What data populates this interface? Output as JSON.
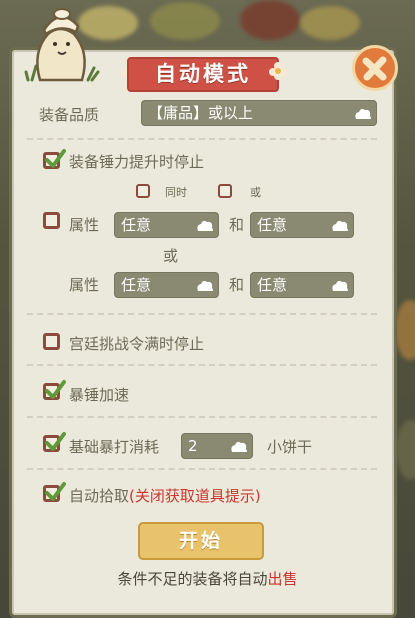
{
  "title": "自动模式",
  "quality": {
    "label": "装备品质",
    "value": "【庸品】或以上"
  },
  "stop_power": {
    "label": "装备锤力提升时停止",
    "checked": true
  },
  "combine": {
    "same_time": "同时",
    "or": "或",
    "same_time_checked": false,
    "or_checked": false
  },
  "attr_row1": {
    "checked": false,
    "label": "属性",
    "value1": "任意",
    "and": "和",
    "value2": "任意"
  },
  "attr_or": "或",
  "attr_row2": {
    "label": "属性",
    "value1": "任意",
    "and": "和",
    "value2": "任意"
  },
  "palace": {
    "label": "宫廷挑战令满时停止",
    "checked": false
  },
  "speed": {
    "label": "暴锤加速",
    "checked": true
  },
  "base": {
    "label": "基础暴打消耗",
    "value": "2",
    "unit": "小饼干",
    "checked": true
  },
  "pickup": {
    "label": "自动拾取",
    "note": "(关闭获取道具提示)",
    "checked": true
  },
  "start_button": "开始",
  "footer": {
    "text": "条件不足的装备将自动",
    "highlight": "出售"
  },
  "colors": {
    "accent": "#cf5146",
    "checkbox": "#8a4a3c",
    "check": "#5f9a3a",
    "dropdown": "#8a8a72",
    "start": "#e9c36b"
  },
  "icons": [
    "mascot-icon",
    "close-icon",
    "flower-icon",
    "cloud-arrow-icon",
    "checkmark-icon"
  ]
}
